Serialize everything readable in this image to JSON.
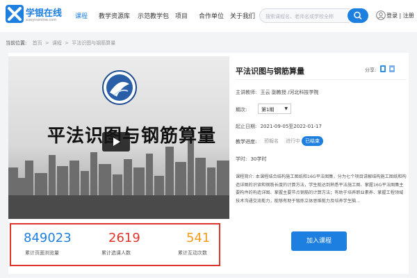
{
  "header": {
    "logo_title": "学银在线",
    "logo_subtitle": "xueyinonline.com",
    "nav": [
      "课程",
      "教学资源库",
      "示范教学包",
      "项目",
      "合作单位",
      "关于我们"
    ],
    "active_nav": "课程",
    "search_placeholder": "搜索课程名、老师名或学校全称",
    "login": "登录 | 注册",
    "accent_color": "#1d7fe0"
  },
  "breadcrumb": {
    "prefix": "当前位置:",
    "items": [
      "首页",
      "课程",
      "平法识图与钢筋算量"
    ],
    "separator": ">"
  },
  "video": {
    "title": "平法识图与钢筋算量"
  },
  "stats": [
    {
      "value": "849023",
      "label": "累计页面浏览量",
      "color": "#1d7fe0"
    },
    {
      "value": "2619",
      "label": "累计选课人数",
      "color": "#e0342a"
    },
    {
      "value": "541",
      "label": "累计互动次数",
      "color": "#f29b1a"
    }
  ],
  "info": {
    "title": "平法识图与钢筋算量",
    "share_label": "分享:",
    "teacher_label": "主讲教师:",
    "teacher_value": "王云 副教授 /河北科技学院",
    "term_label": "期次:",
    "term_value": "第1期",
    "date_label": "起止日期:",
    "date_value": "2021-09-05至2022-01-17",
    "progress_label": "教学进度:",
    "progress_steps": [
      "预報名",
      "进行中",
      "已结束"
    ],
    "progress_active": "已结束",
    "hours_label": "学时:",
    "hours_value": "30学时",
    "desc": "课程简介: 本课程结合结构施工图纸和16G平法图集，分为七个项目讲解结构施工图纸和构造详图的识读和钢筋长度的计算方法，学生能达到熟悉平法施工图、掌握16G平法图集主要构件的构造详图、掌握主要节点钢筋的计算方法；有助于培养职业素养、掌握工程领域技术沟通交流能力，能够有助于锻炼立体思维能力及培养学生脑...",
    "join_button": "加入课程"
  }
}
